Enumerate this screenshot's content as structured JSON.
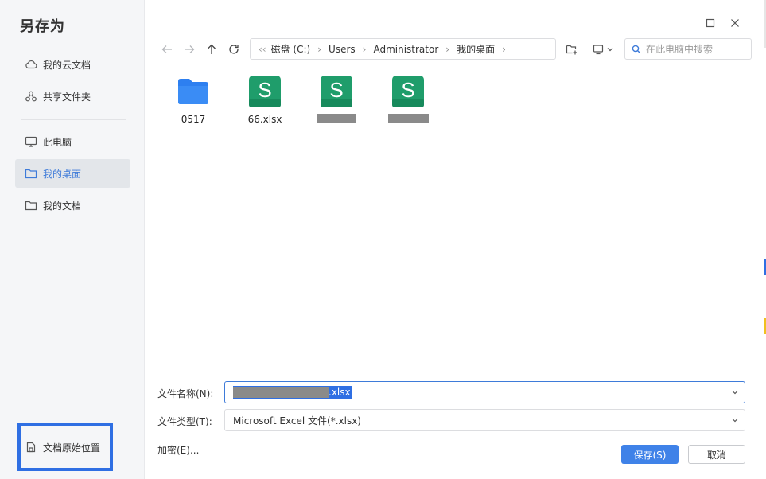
{
  "dialog": {
    "title": "另存为"
  },
  "sidebar": {
    "items": [
      {
        "label": "我的云文档",
        "icon": "cloud-icon"
      },
      {
        "label": "共享文件夹",
        "icon": "share-icon"
      },
      {
        "label": "此电脑",
        "icon": "monitor-icon"
      },
      {
        "label": "我的桌面",
        "icon": "folder-icon",
        "active": true
      },
      {
        "label": "我的文档",
        "icon": "folder-icon"
      }
    ],
    "original_location": "文档原始位置"
  },
  "toolbar": {
    "breadcrumb": [
      "磁盘 (C:)",
      "Users",
      "Administrator",
      "我的桌面"
    ],
    "search_placeholder": "在此电脑中搜索"
  },
  "files": [
    {
      "name": "0517",
      "type": "folder"
    },
    {
      "name": "66.xlsx",
      "type": "spreadsheet"
    },
    {
      "name": "",
      "type": "spreadsheet",
      "redacted": true
    },
    {
      "name": "",
      "type": "spreadsheet",
      "redacted": true
    }
  ],
  "form": {
    "filename_label": "文件名称(N):",
    "filename_ext": ".xlsx",
    "filetype_label": "文件类型(T):",
    "filetype_value": "Microsoft Excel 文件(*.xlsx)",
    "encrypt_label": "加密(E)...",
    "save_label": "保存(S)",
    "cancel_label": "取消"
  },
  "colors": {
    "accent": "#3f82e8",
    "spreadsheet": "#1f9d6b",
    "folder": "#2d7ff0",
    "highlight_box": "#2f6fe3"
  }
}
